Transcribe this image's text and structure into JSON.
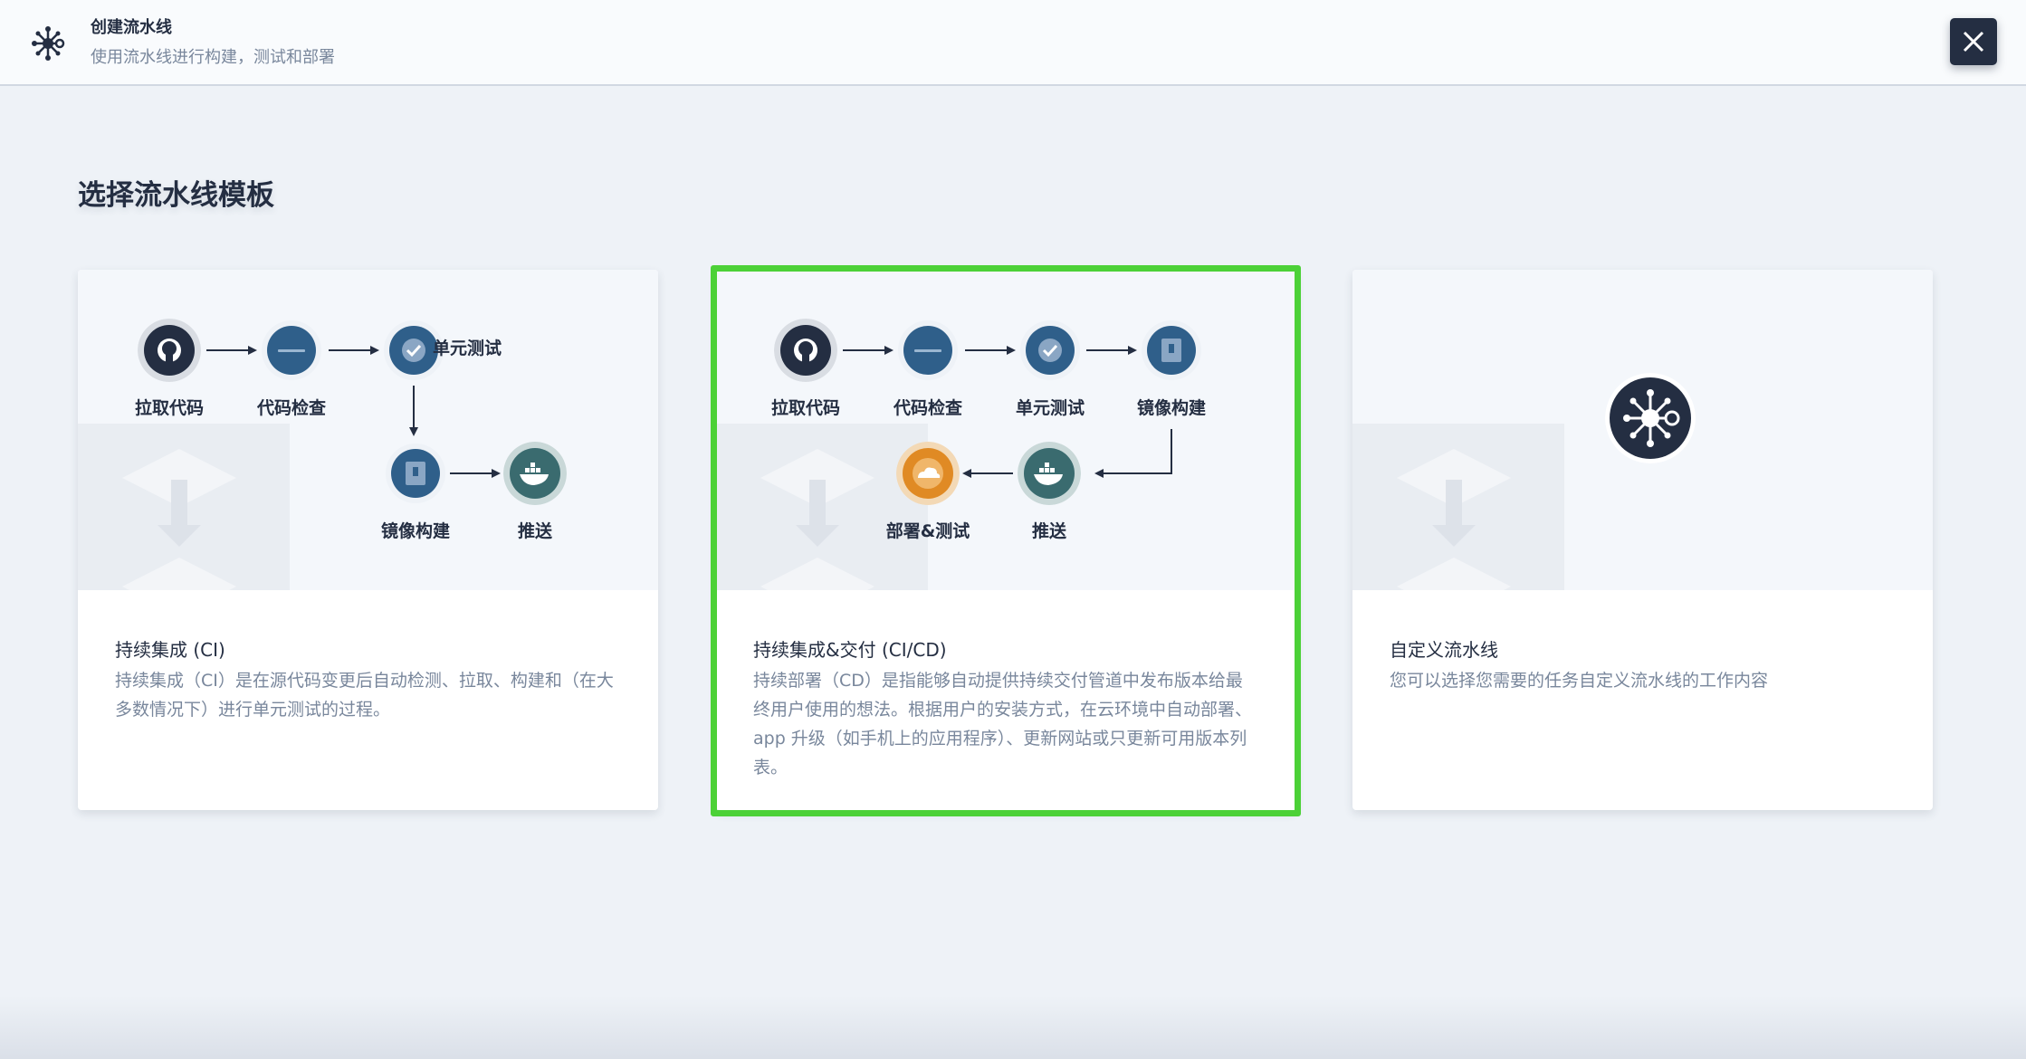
{
  "header": {
    "title": "创建流水线",
    "subtitle": "使用流水线进行构建，测试和部署",
    "icon": "pipeline-icon",
    "close_icon": "close-icon"
  },
  "page_title": "选择流水线模板",
  "colors": {
    "accent_outline": "#4cd137",
    "dark": "#242e42",
    "node_blue": "#2f5f8a",
    "node_teal": "#3a6b6f",
    "node_orange": "#e08a24"
  },
  "cards": [
    {
      "title": "持续集成 (CI)",
      "description": "持续集成（CI）是在源代码变更后自动检测、拉取、构建和（在大多数情况下）进行单元测试的过程。",
      "steps": [
        "拉取代码",
        "代码检查",
        "单元测试",
        "镜像构建",
        "推送"
      ],
      "selected": false
    },
    {
      "title": "持续集成&交付 (CI/CD)",
      "description": "持续部署（CD）是指能够自动提供持续交付管道中发布版本给最终用户使用的想法。根据用户的安装方式，在云环境中自动部署、app 升级（如手机上的应用程序）、更新网站或只更新可用版本列表。",
      "steps": [
        "拉取代码",
        "代码检查",
        "单元测试",
        "镜像构建",
        "推送",
        "部署&测试"
      ],
      "selected": true
    },
    {
      "title": "自定义流水线",
      "description": "您可以选择您需要的任务自定义流水线的工作内容",
      "steps": [],
      "selected": false
    }
  ]
}
